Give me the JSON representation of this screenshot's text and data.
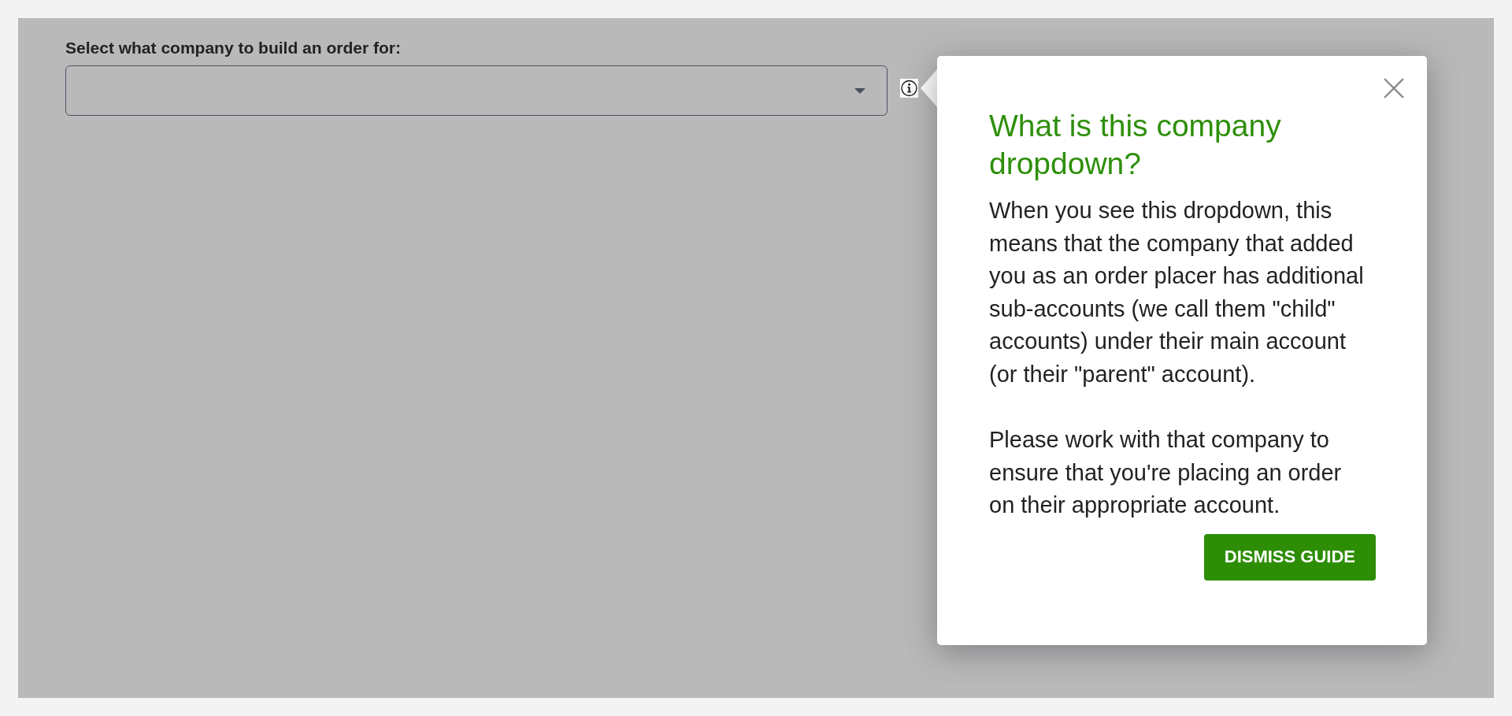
{
  "form": {
    "label": "Select what company to build an order for:"
  },
  "guide": {
    "title": "What is this company dropdown?",
    "paragraphs": [
      "When you see this dropdown, this means that the company that added you as an order placer has additional sub-accounts (we call them \"child\" accounts) under their main account (or their \"parent\" account).",
      "Please work with that company to ensure that you're placing an order on their appropriate account."
    ],
    "button": "DISMISS GUIDE"
  }
}
